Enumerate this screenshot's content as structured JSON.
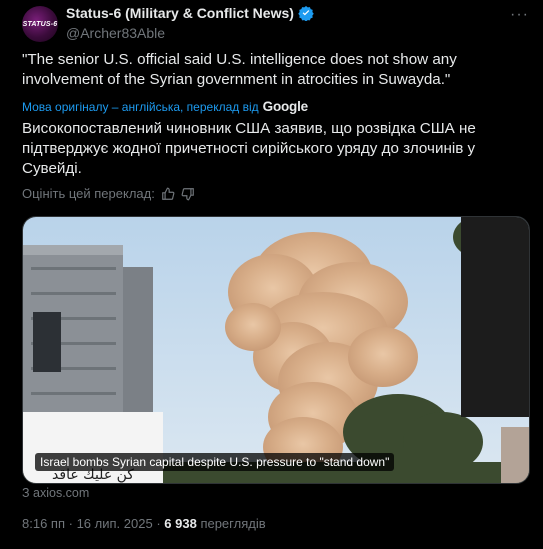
{
  "author": {
    "avatar_text": "STATUS-6",
    "name": "Status-6 (Military & Conflict News)",
    "handle": "@Archer83Able"
  },
  "tweet": {
    "text": "\"The senior U.S. official said U.S. intelligence does not show any involvement of the Syrian government in atrocities in Suwayda.\"",
    "translation_note": "Мова оригіналу – англійська, переклад від",
    "translation_provider": "Google",
    "translated_text": "Високопоставлений чиновник США заявив, що розвідка США не підтверджує жодної причетності сирійського уряду до злочинів у Сувейді.",
    "rate_label": "Оцініть цей переклад:"
  },
  "card": {
    "caption": "Israel bombs Syrian capital despite U.S. pressure to \"stand down\"",
    "source": "З axios.com",
    "sign_text": "كن عليك عاقد"
  },
  "meta": {
    "time": "8:16 пп",
    "date": "16 лип. 2025",
    "views": "6 938",
    "views_label": "переглядів"
  },
  "colors": {
    "accent": "#1d9bf0",
    "muted": "#71767b",
    "text": "#e7e9ea"
  }
}
